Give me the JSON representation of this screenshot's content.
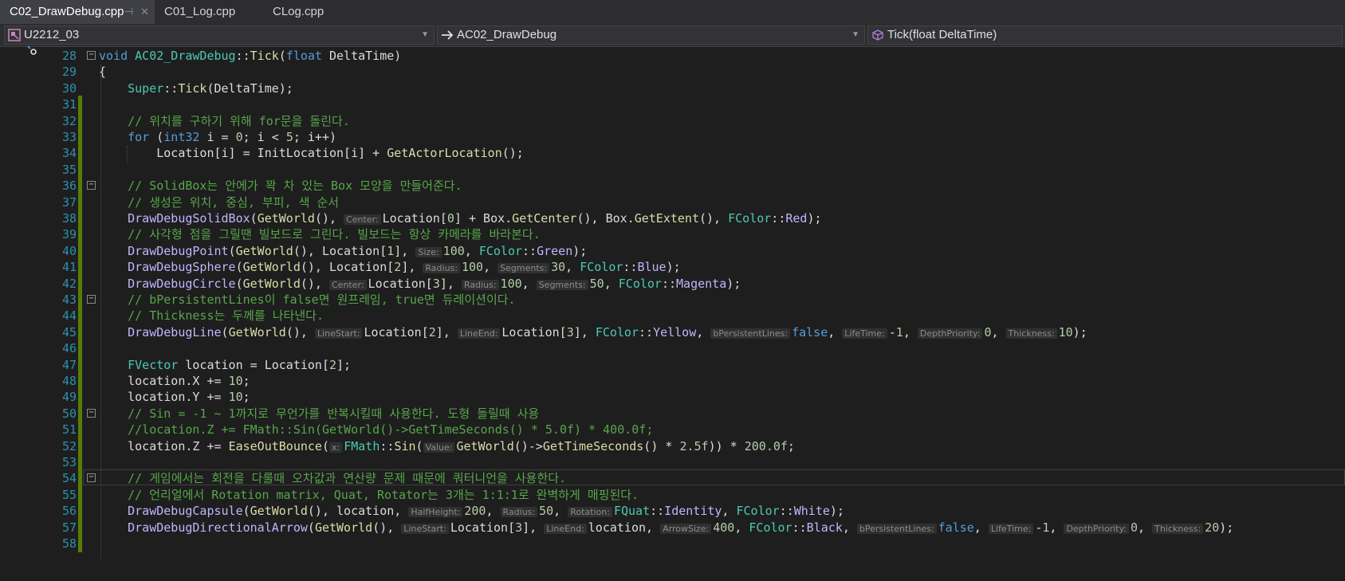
{
  "tabs": [
    {
      "label": "C02_DrawDebug.cpp",
      "active": true
    },
    {
      "label": "C01_Log.cpp",
      "active": false
    },
    {
      "label": "CLog.cpp",
      "active": false
    }
  ],
  "nav": {
    "project": "U2212_03",
    "class": "AC02_DrawDebug",
    "member": "Tick(float DeltaTime)"
  },
  "lines": [
    {
      "n": "28",
      "t": "void AC02_DrawDebug::Tick(float DeltaTime)"
    },
    {
      "n": "29",
      "t": "{"
    },
    {
      "n": "30",
      "t": "    Super::Tick(DeltaTime);"
    },
    {
      "n": "31",
      "t": ""
    },
    {
      "n": "32",
      "t": "    // 위치를 구하기 위해 for문을 돌린다."
    },
    {
      "n": "33",
      "t": "    for (int32 i = 0; i < 5; i++)"
    },
    {
      "n": "34",
      "t": "        Location[i] = InitLocation[i] + GetActorLocation();"
    },
    {
      "n": "35",
      "t": ""
    },
    {
      "n": "36",
      "t": "    // SolidBox는 안에가 꽉 차 있는 Box 모양을 만들어준다."
    },
    {
      "n": "37",
      "t": "    // 생성은 위치, 중심, 부피, 색 순서"
    },
    {
      "n": "38",
      "t": "    DrawDebugSolidBox(GetWorld(), Center:Location[0] + Box.GetCenter(), Box.GetExtent(), FColor::Red);"
    },
    {
      "n": "39",
      "t": "    // 사각형 점을 그릴땐 빌보드로 그린다. 빌보드는 항상 카메라를 바라본다."
    },
    {
      "n": "40",
      "t": "    DrawDebugPoint(GetWorld(), Location[1], Size:100, FColor::Green);"
    },
    {
      "n": "41",
      "t": "    DrawDebugSphere(GetWorld(), Location[2], Radius:100, Segments:30, FColor::Blue);"
    },
    {
      "n": "42",
      "t": "    DrawDebugCircle(GetWorld(), Center:Location[3], Radius:100, Segments:50, FColor::Magenta);"
    },
    {
      "n": "43",
      "t": "    // bPersistentLines이 false면 원프레임, true면 듀레이션이다."
    },
    {
      "n": "44",
      "t": "    // Thickness는 두께를 나타낸다."
    },
    {
      "n": "45",
      "t": "    DrawDebugLine(GetWorld(), LineStart:Location[2], LineEnd:Location[3], FColor::Yellow, bPersistentLines:false, LifeTime:-1, DepthPriority:0, Thickness:10);"
    },
    {
      "n": "46",
      "t": ""
    },
    {
      "n": "47",
      "t": "    FVector location = Location[2];"
    },
    {
      "n": "48",
      "t": "    location.X += 10;"
    },
    {
      "n": "49",
      "t": "    location.Y += 10;"
    },
    {
      "n": "50",
      "t": "    // Sin = -1 ~ 1까지로 무언가를 반복시킬때 사용한다. 도형 돌릴때 사용"
    },
    {
      "n": "51",
      "t": "    //location.Z += FMath::Sin(GetWorld()->GetTimeSeconds() * 5.0f) * 400.0f;"
    },
    {
      "n": "52",
      "t": "    location.Z += EaseOutBounce(x:FMath::Sin(Value:GetWorld()->GetTimeSeconds() * 2.5f)) * 200.0f;"
    },
    {
      "n": "53",
      "t": ""
    },
    {
      "n": "54",
      "t": "    // 게임에서는 회전을 다룰때 오차값과 연산량 문제 때문에 쿼터니언을 사용한다."
    },
    {
      "n": "55",
      "t": "    // 언리얼에서 Rotation matrix, Quat, Rotator는 3개는 1:1:1로 완벽하게 매핑된다."
    },
    {
      "n": "56",
      "t": "    DrawDebugCapsule(GetWorld(), location, HalfHeight:200, Radius:50, Rotation:FQuat::Identity, FColor::White);"
    },
    {
      "n": "57",
      "t": "    DrawDebugDirectionalArrow(GetWorld(), LineStart:Location[3], LineEnd:location, ArrowSize:400, FColor::Black, bPersistentLines:false, LifeTime:-1, DepthPriority:0, Thickness:20);"
    },
    {
      "n": "58",
      "t": ""
    }
  ],
  "colors": {
    "background": "#1e1e1e",
    "keyword": "#569cd6",
    "comment": "#57a64a",
    "type": "#4ec9b0",
    "function": "#dcdcaa",
    "linenumber": "#2b91af",
    "change_bar": "#587c0c"
  },
  "icons": [
    "pin-icon",
    "close-icon",
    "project-icon",
    "arrow-right-icon",
    "cube-icon",
    "chevron-down-icon"
  ]
}
